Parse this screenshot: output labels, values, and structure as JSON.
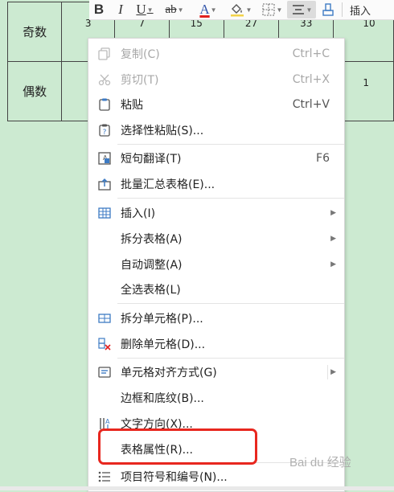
{
  "table": {
    "rows": [
      {
        "label": "奇数",
        "cells": [
          "3",
          "7",
          "15",
          "27",
          "33",
          "10"
        ]
      },
      {
        "label": "偶数",
        "cells": [
          "",
          "",
          "",
          "",
          "",
          "1"
        ]
      }
    ]
  },
  "toolbar": {
    "bold": "B",
    "italic": "I",
    "underline": "U",
    "font": "ab",
    "color": "A",
    "insert_label": "插入"
  },
  "menu": {
    "items": [
      {
        "label": "复制(C)",
        "shortcut": "Ctrl+C",
        "disabled": true
      },
      {
        "label": "剪切(T)",
        "shortcut": "Ctrl+X",
        "disabled": true
      },
      {
        "label": "粘贴",
        "shortcut": "Ctrl+V"
      },
      {
        "label": "选择性粘贴(S)..."
      },
      {
        "label": "短句翻译(T)",
        "shortcut": "F6"
      },
      {
        "label": "批量汇总表格(E)..."
      },
      {
        "label": "插入(I)",
        "submenu": true
      },
      {
        "label": "拆分表格(A)",
        "submenu": true
      },
      {
        "label": "自动调整(A)",
        "submenu": true
      },
      {
        "label": "全选表格(L)"
      },
      {
        "label": "拆分单元格(P)..."
      },
      {
        "label": "删除单元格(D)..."
      },
      {
        "label": "单元格对齐方式(G)",
        "submenu": true
      },
      {
        "label": "边框和底纹(B)..."
      },
      {
        "label": "文字方向(X)..."
      },
      {
        "label": "表格属性(R)...",
        "highlighted": true
      },
      {
        "label": "项目符号和编号(N)..."
      }
    ]
  },
  "watermark": "Bai du 经验",
  "colors": {
    "background": "#ccead1",
    "highlight": "#e8271f",
    "disabled": "#a8a8a8"
  }
}
